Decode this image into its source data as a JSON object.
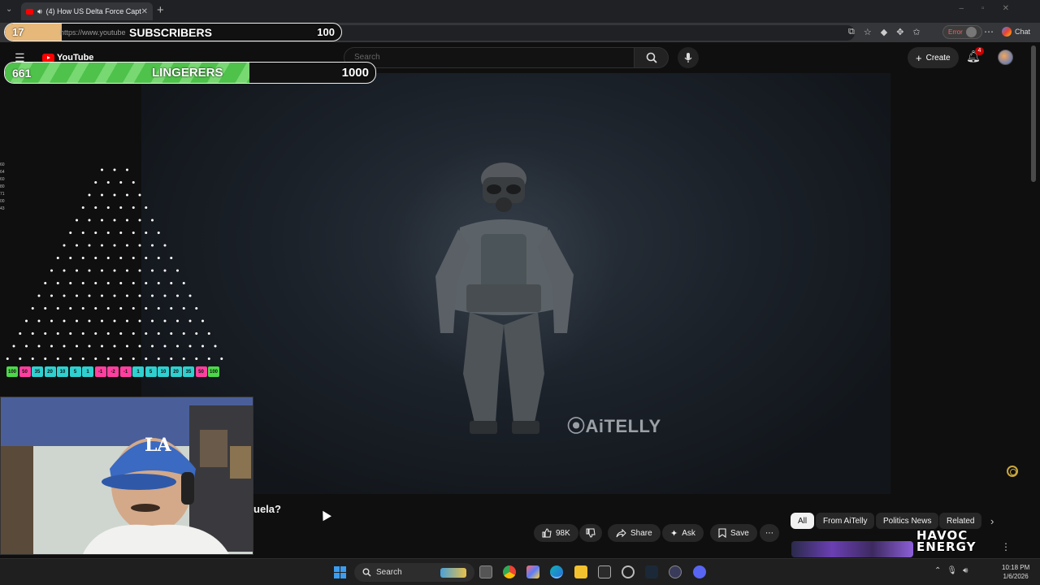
{
  "browser": {
    "tab_title": "(4) How US Delta Force Captu",
    "url": "https://www.youtube",
    "url_tail": "o",
    "error_label": "Error",
    "chat_label": "Chat"
  },
  "overlay": {
    "subscribers": {
      "label": "SUBSCRIBERS",
      "current": "17",
      "goal": "100",
      "progress": 0.17,
      "color": "#e6b87a"
    },
    "lingerers": {
      "label": "LINGERERS",
      "current": "661",
      "goal": "1000",
      "progress": 0.661,
      "color": "#4ec24a"
    },
    "plinko_side_numbers": [
      "60",
      "64",
      "60",
      "80",
      "71",
      "00",
      "43"
    ],
    "plinko_slots": [
      {
        "value": "100",
        "color": "#4cd84a"
      },
      {
        "value": "50",
        "color": "#ff3fa0"
      },
      {
        "value": "35",
        "color": "#2fd0d0"
      },
      {
        "value": "20",
        "color": "#2fd0d0"
      },
      {
        "value": "10",
        "color": "#2fd0d0"
      },
      {
        "value": "5",
        "color": "#2fd0d0"
      },
      {
        "value": "1",
        "color": "#2fd0d0"
      },
      {
        "value": "-1",
        "color": "#ff3fa0"
      },
      {
        "value": "-2",
        "color": "#ff3fa0"
      },
      {
        "value": "-1",
        "color": "#ff3fa0"
      },
      {
        "value": "1",
        "color": "#2fd0d0"
      },
      {
        "value": "5",
        "color": "#2fd0d0"
      },
      {
        "value": "10",
        "color": "#2fd0d0"
      },
      {
        "value": "20",
        "color": "#2fd0d0"
      },
      {
        "value": "35",
        "color": "#2fd0d0"
      },
      {
        "value": "50",
        "color": "#ff3fa0"
      },
      {
        "value": "100",
        "color": "#4cd84a"
      }
    ]
  },
  "youtube": {
    "logo_text": "YouTube",
    "search_placeholder": "Search",
    "create_label": "Create",
    "notification_count": "4",
    "video_watermark": "⦿AiTELLY",
    "title_fragment": "uela?",
    "actions": {
      "like_count": "98K",
      "share_label": "Share",
      "ask_label": "Ask",
      "save_label": "Save"
    },
    "chips": [
      "All",
      "From AiTelly",
      "Politics News",
      "Related"
    ],
    "havoc_line1": "HAVOC",
    "havoc_line2": "ENERGY"
  },
  "taskbar": {
    "search_label": "Search",
    "time": "10:18 PM",
    "date": "1/6/2026"
  }
}
